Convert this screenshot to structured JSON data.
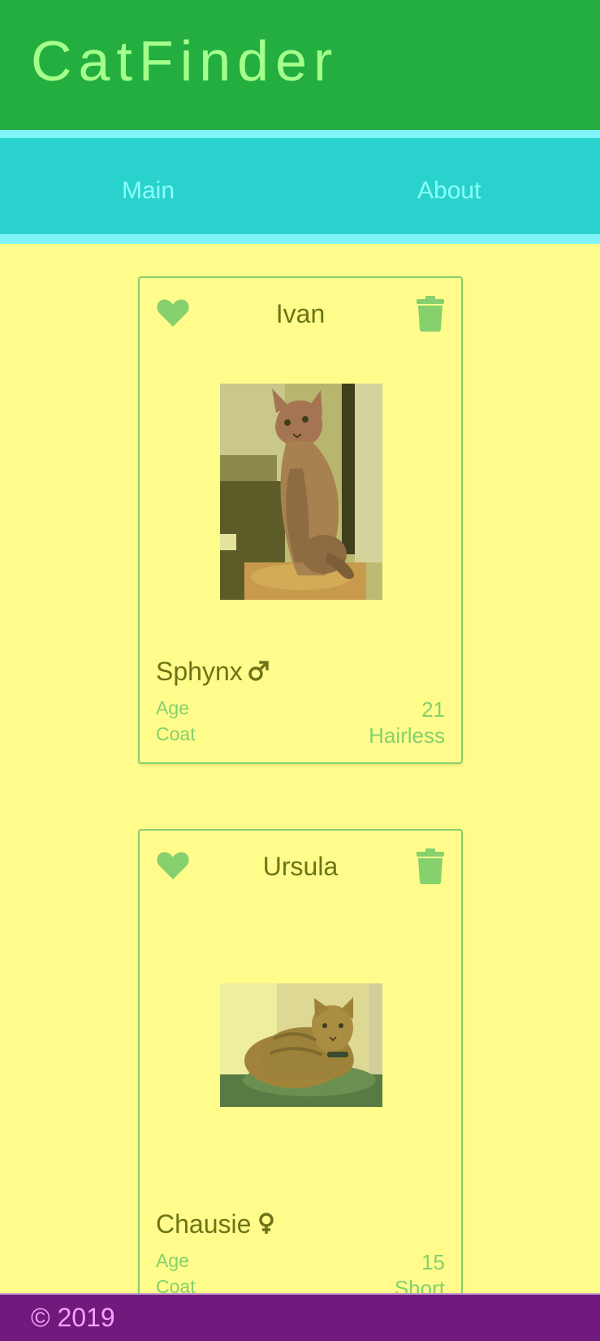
{
  "header": {
    "app_title": "CatFinder"
  },
  "nav": {
    "items": [
      {
        "label": "Main"
      },
      {
        "label": "About"
      }
    ]
  },
  "cats": [
    {
      "name": "Ivan",
      "breed": "Sphynx",
      "gender": "male",
      "gender_symbol": "♂",
      "age_label": "Age",
      "age": "21",
      "coat_label": "Coat",
      "coat": "Hairless"
    },
    {
      "name": "Ursula",
      "breed": "Chausie",
      "gender": "female",
      "gender_symbol": "♀",
      "age_label": "Age",
      "age": "15",
      "coat_label": "Coat",
      "coat": "Short"
    }
  ],
  "footer": {
    "copyright": "© 2019"
  },
  "colors": {
    "header_bg": "#23ae3f",
    "nav_bg": "#2ad2ce",
    "page_bg": "#fffc8c",
    "accent_green": "#86d06d",
    "text_olive": "#6e7416",
    "footer_bg": "#6f1a7c",
    "footer_text": "#ff9cff"
  },
  "icons": {
    "favorite": "heart-icon",
    "delete": "trash-icon",
    "male": "male-symbol-icon",
    "female": "female-symbol-icon"
  }
}
